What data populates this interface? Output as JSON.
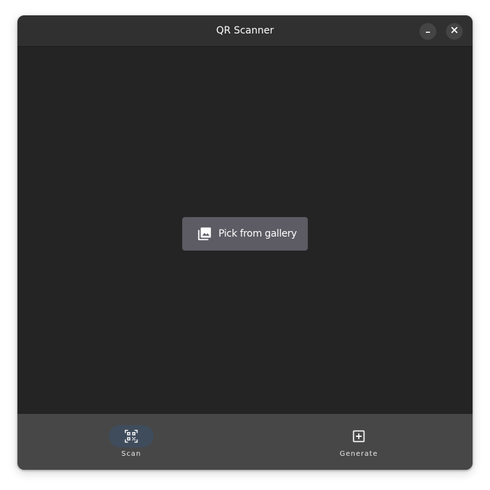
{
  "window": {
    "title": "QR Scanner"
  },
  "main": {
    "pick_gallery_label": "Pick from gallery"
  },
  "bottom_nav": {
    "items": [
      {
        "label": "Scan",
        "icon": "qr-scan-icon",
        "selected": true
      },
      {
        "label": "Generate",
        "icon": "add-box-icon",
        "selected": false
      }
    ]
  },
  "colors": {
    "window_bg": "#242424",
    "headerbar_bg": "#303030",
    "gallery_button_bg": "#5d5b63",
    "bottom_nav_bg": "#474747",
    "nav_indicator_bg": "#3f4c5c"
  }
}
